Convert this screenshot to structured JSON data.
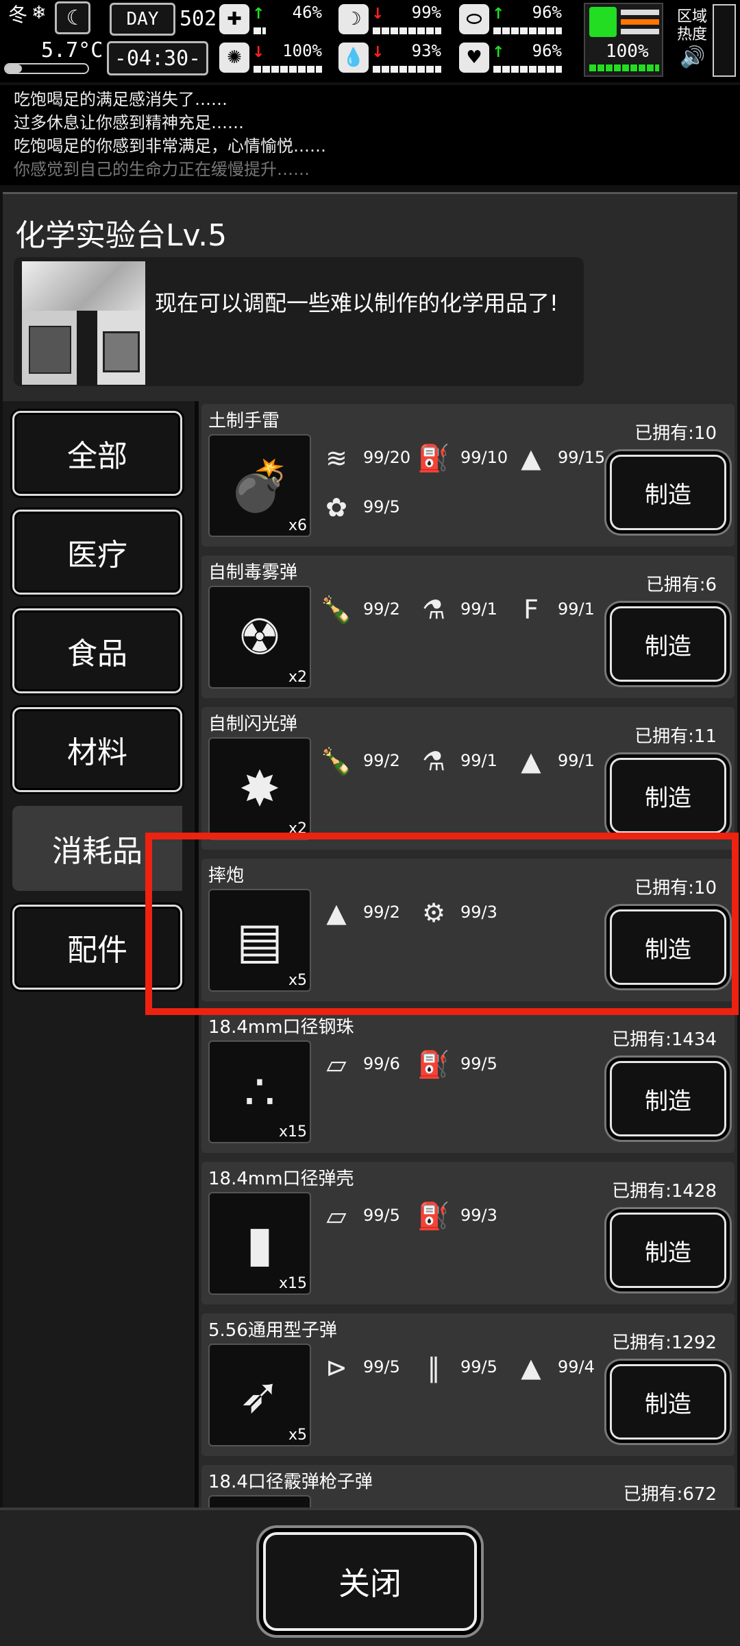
{
  "status": {
    "season": "冬",
    "day_label": "DAY",
    "day": "502",
    "temperature": "5.7°C",
    "time": "-04:30-",
    "stats_top": [
      {
        "name": "health",
        "icon": "first-aid-icon",
        "trend": "up",
        "value": "46%"
      },
      {
        "name": "hunger",
        "icon": "stomach-icon",
        "trend": "down",
        "value": "99%"
      },
      {
        "name": "energy",
        "icon": "capsule-icon",
        "trend": "up",
        "value": "96%"
      }
    ],
    "stats_bottom": [
      {
        "name": "brain",
        "icon": "brain-icon",
        "trend": "down",
        "value": "100%"
      },
      {
        "name": "thirst",
        "icon": "water-drop-icon",
        "trend": "down",
        "value": "93%"
      },
      {
        "name": "mood",
        "icon": "heart-icon",
        "trend": "up",
        "value": "96%"
      }
    ],
    "boot_value": "100%",
    "zone_label_1": "区域",
    "zone_label_2": "热度"
  },
  "log": [
    "吃饱喝足的满足感消失了……",
    "过多休息让你感到精神充足……",
    "吃饱喝足的你感到非常满足，心情愉悦……",
    "你感觉到自己的生命力正在缓慢提升……"
  ],
  "station": {
    "title": "化学实验台Lv.5",
    "description": "现在可以调配一些难以制作的化学用品了!"
  },
  "categories": [
    "全部",
    "医疗",
    "食品",
    "材料",
    "消耗品",
    "配件"
  ],
  "active_category": "消耗品",
  "craft_label": "制造",
  "recipes": [
    {
      "name": "土制手雷",
      "owned": "已拥有:10",
      "mult": "x6",
      "icon": "grenade-icon",
      "materials": [
        {
          "icon": "cloth-icon",
          "text": "99/20"
        },
        {
          "icon": "fuel-can-icon",
          "text": "99/10"
        },
        {
          "icon": "powder-icon",
          "text": "99/15"
        },
        {
          "icon": "cotton-icon",
          "text": "99/5"
        }
      ]
    },
    {
      "name": "自制毒雾弹",
      "owned": "已拥有:6",
      "mult": "x2",
      "icon": "poison-bottle-icon",
      "materials": [
        {
          "icon": "bottle-icon",
          "text": "99/2"
        },
        {
          "icon": "flask-icon",
          "text": "99/1"
        },
        {
          "icon": "fertilizer-icon",
          "text": "99/1"
        }
      ]
    },
    {
      "name": "自制闪光弹",
      "owned": "已拥有:11",
      "mult": "x2",
      "icon": "flashbang-icon",
      "materials": [
        {
          "icon": "bottle-icon",
          "text": "99/2"
        },
        {
          "icon": "flask-icon",
          "text": "99/1"
        },
        {
          "icon": "powder-icon",
          "text": "99/1"
        }
      ]
    },
    {
      "name": "摔炮",
      "owned": "已拥有:10",
      "mult": "x5",
      "icon": "firecracker-box-icon",
      "materials": [
        {
          "icon": "powder-icon",
          "text": "99/2"
        },
        {
          "icon": "scrap-icon",
          "text": "99/3"
        }
      ]
    },
    {
      "name": "18.4mm口径钢珠",
      "owned": "已拥有:1434",
      "mult": "x15",
      "icon": "steel-balls-icon",
      "materials": [
        {
          "icon": "metal-plate-icon",
          "text": "99/6"
        },
        {
          "icon": "fuel-can-icon",
          "text": "99/5"
        }
      ]
    },
    {
      "name": "18.4mm口径弹壳",
      "owned": "已拥有:1428",
      "mult": "x15",
      "icon": "shell-casing-icon",
      "materials": [
        {
          "icon": "metal-plate-icon",
          "text": "99/5"
        },
        {
          "icon": "fuel-can-icon",
          "text": "99/3"
        }
      ]
    },
    {
      "name": "5.56通用型子弹",
      "owned": "已拥有:1292",
      "mult": "x5",
      "icon": "bullet-icon",
      "materials": [
        {
          "icon": "bullet-tip-icon",
          "text": "99/5"
        },
        {
          "icon": "casing-pair-icon",
          "text": "99/5"
        },
        {
          "icon": "powder-icon",
          "text": "99/4"
        }
      ]
    },
    {
      "name": "18.4口径霰弹枪子弹",
      "owned": "已拥有:672",
      "mult": "",
      "icon": "shotgun-shell-icon",
      "materials": []
    }
  ],
  "close_label": "关闭"
}
